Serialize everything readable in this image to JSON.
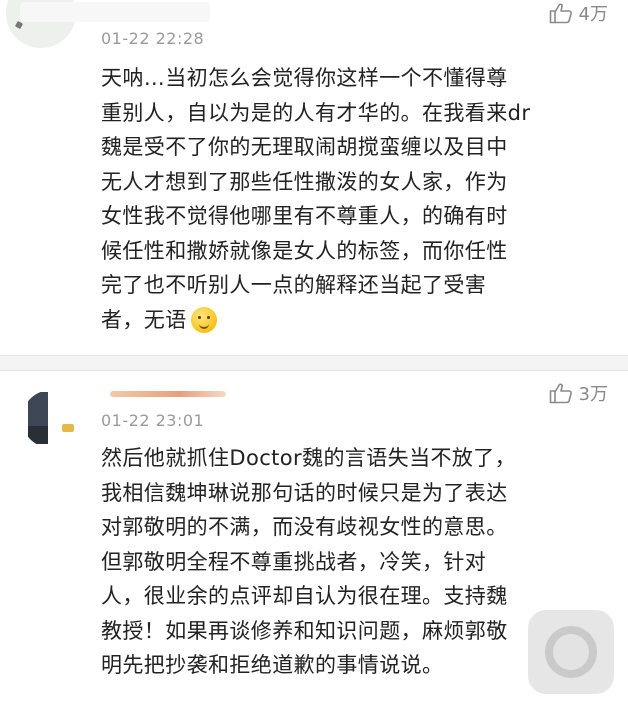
{
  "comments": [
    {
      "time": "01-22 22:28",
      "likes": "4万",
      "lines": [
        "天呐…当初怎么会觉得你这样一个不懂得尊",
        "重别人，自以为是的人有才华的。在我看来dr",
        "魏是受不了你的无理取闹胡搅蛮缠以及目中",
        "无人才想到了那些任性撒泼的女人家，作为",
        "女性我不觉得他哪里有不尊重人，的确有时",
        "候任性和撒娇就像是女人的标签，而你任性",
        "完了也不听别人一点的解释还当起了受害",
        "者，无语"
      ]
    },
    {
      "time": "01-22 23:01",
      "likes": "3万",
      "lines": [
        "然后他就抓住Doctor魏的言语失当不放了，",
        "我相信魏坤琳说那句话的时候只是为了表达",
        "对郭敬明的不满，而没有歧视女性的意思。",
        "但郭敬明全程不尊重挑战者，冷笑，针对",
        "人，很业余的点评却自认为很在理。支持魏",
        "教授！如果再谈修养和知识问题，麻烦郭敬",
        "明先把抄袭和拒绝道歉的事情说说。"
      ]
    }
  ],
  "icons": {
    "like": "thumbs-up-icon",
    "emoji": "thinking-face-emoji-icon",
    "home": "assistive-touch-icon"
  },
  "colors": {
    "text": "#222222",
    "meta": "#9a9a9a",
    "divider": "#f4f4f4"
  }
}
